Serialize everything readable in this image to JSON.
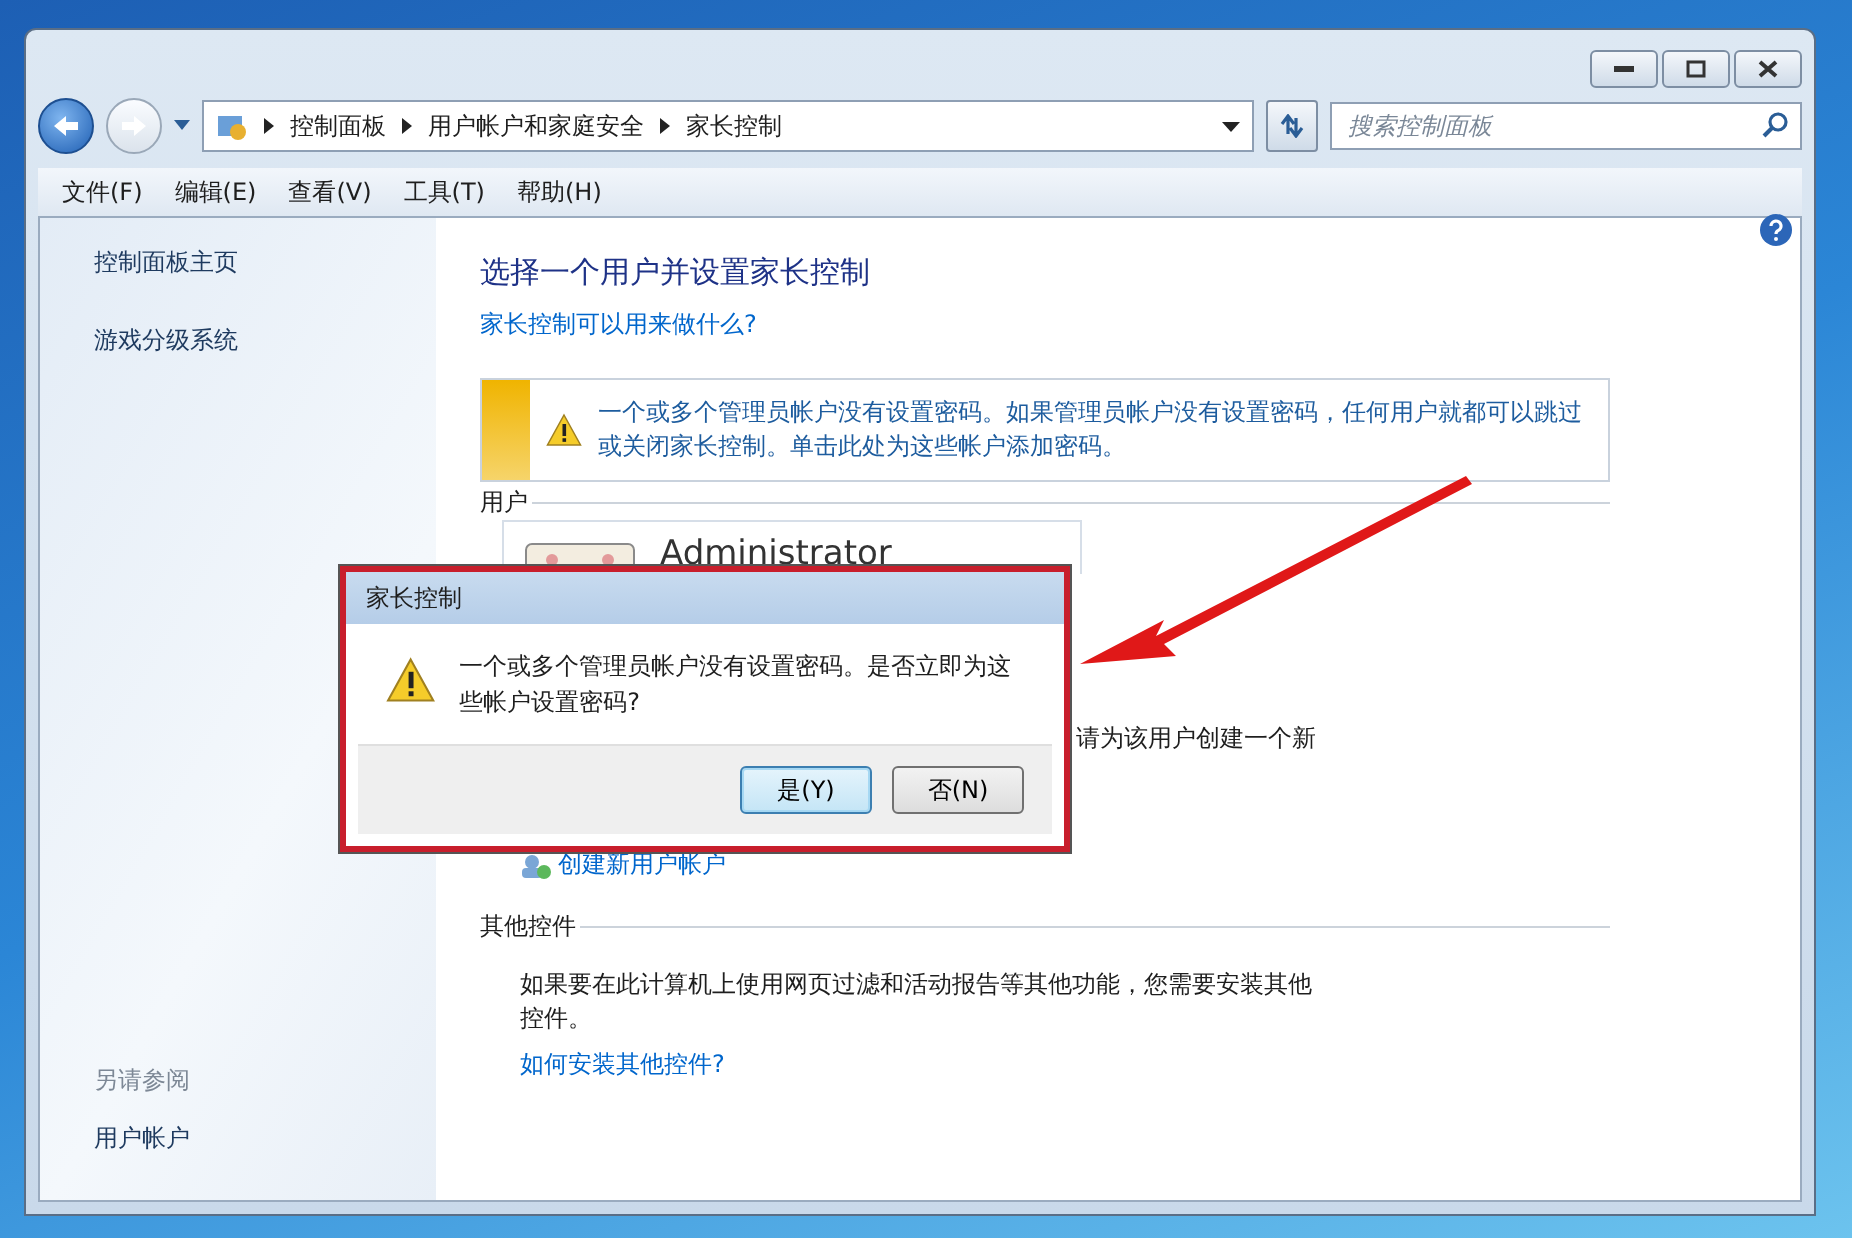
{
  "address_bar": {
    "breadcrumbs": [
      "控制面板",
      "用户帐户和家庭安全",
      "家长控制"
    ]
  },
  "search": {
    "placeholder": "搜索控制面板"
  },
  "menu": [
    "文件(F)",
    "编辑(E)",
    "查看(V)",
    "工具(T)",
    "帮助(H)"
  ],
  "sidebar": {
    "links": [
      "控制面板主页",
      "游戏分级系统"
    ],
    "see_also_heading": "另请参阅",
    "see_also": [
      "用户帐户"
    ]
  },
  "main": {
    "title": "选择一个用户并设置家长控制",
    "help_link": "家长控制可以用来做什么?",
    "warning": "一个或多个管理员帐户没有设置密码。如果管理员帐户没有设置密码，任何用户就都可以跳过或关闭家长控制。单击此处为这些帐户添加密码。",
    "users_heading": "用户",
    "user_name": "Administrator",
    "partial_text": "请为该用户创建一个新",
    "create_link": "创建新用户帐户",
    "other_heading": "其他控件",
    "other_text": "如果要在此计算机上使用网页过滤和活动报告等其他功能，您需要安装其他控件。",
    "other_link": "如何安装其他控件?"
  },
  "dialog": {
    "title": "家长控制",
    "message": "一个或多个管理员帐户没有设置密码。是否立即为这些帐户设置密码?",
    "buttons": [
      {
        "label": "是(Y)",
        "focused": true
      },
      {
        "label": "否(N)",
        "focused": false
      }
    ]
  }
}
